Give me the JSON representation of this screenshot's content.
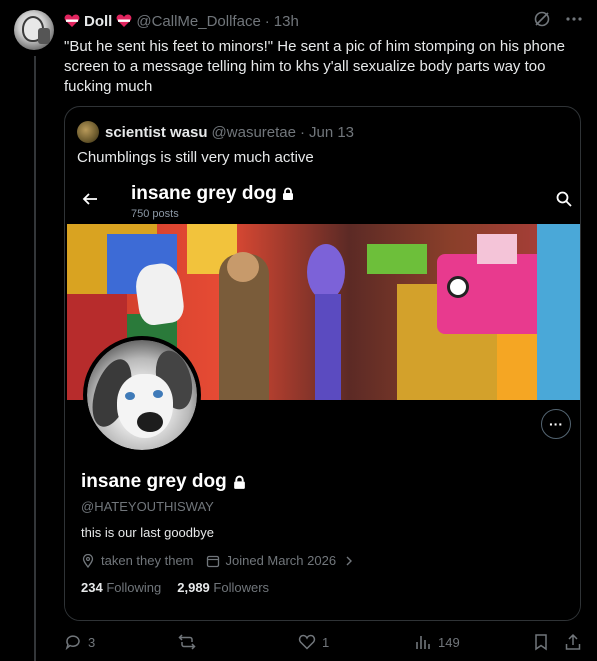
{
  "post": {
    "author_name": "Doll",
    "author_handle": "@CallMe_Dollface",
    "separator": "·",
    "time": "13h",
    "text": "\"But he sent his feet to minors!\" He sent a pic of him stomping on his phone screen to a message telling him to khs y'all sexualize body parts way too fucking much"
  },
  "quote": {
    "author_name": "scientist wasu",
    "author_handle": "@wasuretae",
    "separator": "·",
    "date": "Jun 13",
    "text": "Chumblings is still very much active"
  },
  "profile": {
    "name": "insane grey dog",
    "post_count": "750 posts",
    "handle": "@HATEYOUTHISWAY",
    "bio": "this is our last goodbye",
    "location": "taken they them",
    "joined": "Joined March 2026",
    "following_count": "234",
    "following_label": "Following",
    "followers_count": "2,989",
    "followers_label": "Followers",
    "more_label": "···"
  },
  "actions": {
    "replies": "3",
    "likes": "1",
    "views": "149"
  },
  "colors": {
    "background": "#000000",
    "text": "#e7e9ea",
    "muted": "#71767b",
    "border": "#2f3336",
    "heart": "#e0245e"
  }
}
